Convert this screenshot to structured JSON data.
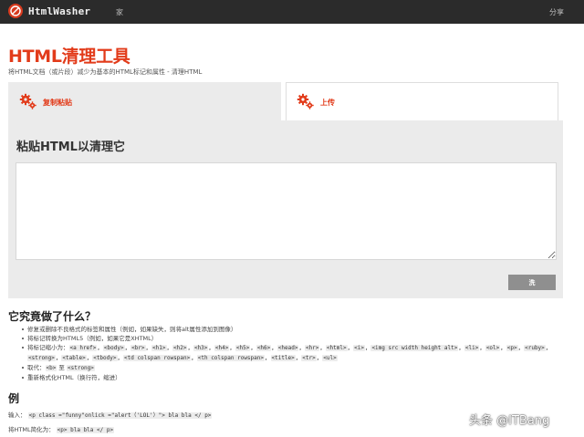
{
  "header": {
    "brand": "HtmlWasher",
    "nav_home": "家",
    "nav_share": "分享"
  },
  "title": "HTML清理工具",
  "subtitle": "将HTML文档（或片段）减少为基本的HTML标记和属性 - 清理HTML",
  "tabs": [
    {
      "label": "复制粘贴",
      "active": true
    },
    {
      "label": "上传",
      "active": false
    }
  ],
  "panel": {
    "heading": "粘贴HTML以清理它",
    "textarea_value": "",
    "clean_button": "洗"
  },
  "what": {
    "heading": "它究竟做了什么？",
    "items": {
      "fix": "修复或删除不良格式的标签和属性（例如，如果缺失，则将alt属性添加到图像）",
      "convert": "将标记转换为HTML5（例如，如果它是XHTML）",
      "reduce_prefix": "将标记缩小为：",
      "reduce_tags": [
        "<a href>",
        "<body>",
        "<br>",
        "<h1>",
        "<h2>",
        "<h3>",
        "<h4>",
        "<h5>",
        "<h6>",
        "<head>",
        "<hr>",
        "<html>",
        "<i>",
        "<img src width height alt>",
        "<li>",
        "<ol>",
        "<p>",
        "<ruby>",
        "<strong>",
        "<table>",
        "<tbody>",
        "<td colspan rowspan>",
        "<th colspan rowspan>",
        "<title>",
        "<tr>",
        "<ul>"
      ],
      "replace_prefix": "取代：",
      "replace_from": "<b>",
      "replace_mid": "至",
      "replace_to": "<strong>",
      "reformat": "重新格式化HTML（换行符，缩进）"
    }
  },
  "example": {
    "heading": "例",
    "input_label": "输入：",
    "input_code": "<p class =\"funny\"onlick =\"alert（'LOL'）\"> bla bla </ p>",
    "output_label": "将HTML简化为：",
    "output_code": "<p> bla bla </ p>"
  },
  "watermark": "头条 @ITBang",
  "colors": {
    "accent": "#e23b1a",
    "topbar": "#2b2b2b",
    "panel": "#ebebeb",
    "button": "#8f8f8f"
  }
}
